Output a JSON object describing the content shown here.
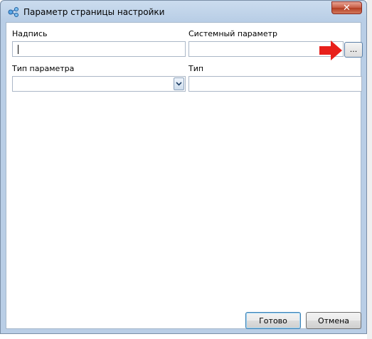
{
  "window": {
    "title": "Параметр страницы настройки",
    "close_glyph": "✕"
  },
  "fields": {
    "caption_label": "Надпись",
    "caption_value": "",
    "system_param_label": "Системный параметр",
    "system_param_value": "",
    "browse_button_label": "...",
    "param_type_label": "Тип параметра",
    "param_type_selected": "",
    "type_label": "Тип",
    "type_value": ""
  },
  "buttons": {
    "ok_label": "Готово",
    "cancel_label": "Отмена"
  },
  "icons": {
    "title_icon": "settings-nodes-icon",
    "dropdown_icon": "chevron-down-icon",
    "annotation": "red-arrow-icon"
  },
  "colors": {
    "annotation_arrow": "#e8201b",
    "title_bar": "#b9cee6",
    "close_button": "#c75b43"
  }
}
